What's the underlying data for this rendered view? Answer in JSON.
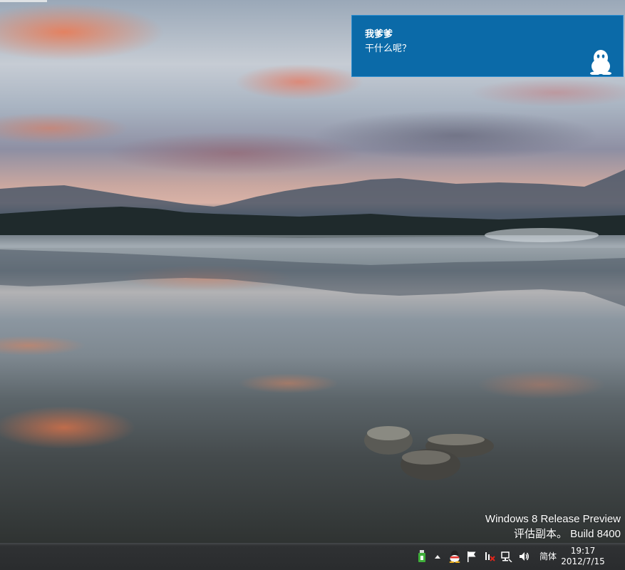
{
  "notification": {
    "title": "我爹爹",
    "message": "干什么呢？",
    "app_icon": "qq-penguin-icon",
    "background": "#0b6aa8"
  },
  "watermark": {
    "line1": "Windows 8 Release Preview",
    "line2": "评估副本。 Build 8400"
  },
  "taskbar": {
    "tray_icons": [
      "usb-device-icon",
      "show-hidden-icons-chevron",
      "qq-icon",
      "action-center-flag-icon",
      "network-disconnected-icon",
      "wired-network-icon",
      "volume-icon"
    ],
    "ime_label": "简体",
    "clock_time": "19:17",
    "clock_date": "2012/7/15"
  }
}
